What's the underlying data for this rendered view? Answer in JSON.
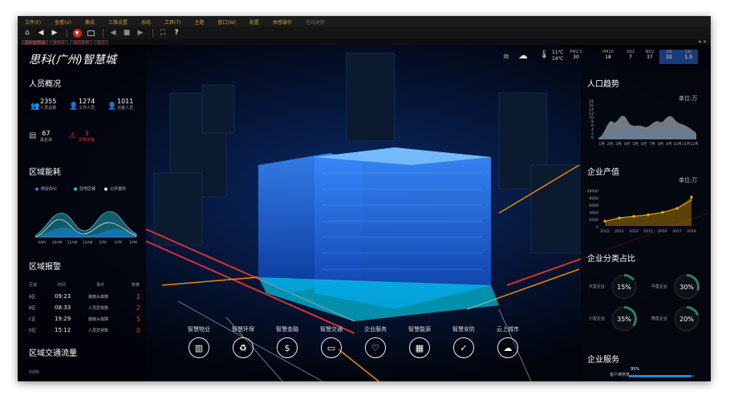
{
  "menubar": [
    "文件(F)",
    "查看(V)",
    "集成",
    "三维设置",
    "系统",
    "工具(T)",
    "主题",
    "窗口(W)",
    "配置",
    "体感操作",
    "在线更新"
  ],
  "tabs": [
    "思科智慧城",
    "宣传片",
    "消防系统",
    "首页"
  ],
  "app": {
    "title": "思科(广州)智慧城"
  },
  "weather": {
    "condition": "阴",
    "temp_high": "11℃",
    "temp_low": "14℃"
  },
  "air": [
    {
      "label": "PM2.5",
      "value": "30"
    },
    {
      "label": "PM10",
      "value": "18"
    },
    {
      "label": "SO2",
      "value": "7"
    },
    {
      "label": "NO2",
      "value": "37"
    },
    {
      "label": "O3",
      "value": "32"
    },
    {
      "label": "CO",
      "value": "1.3"
    }
  ],
  "people": {
    "title": "人员概况",
    "stats": [
      {
        "num": "2355",
        "label": "人员总数",
        "icon": "users-icon"
      },
      {
        "num": "1274",
        "label": "工作人员",
        "icon": "user-icon"
      },
      {
        "num": "1011",
        "label": "访客人员",
        "icon": "visitor-icon"
      }
    ],
    "blacklist": {
      "num": "67",
      "label": "黑名单"
    },
    "abnormal": {
      "num": "3",
      "label": "异常访客"
    }
  },
  "energy": {
    "title": "区域能耗",
    "legend": [
      {
        "label": "商业办公",
        "color": "#1e88e5"
      },
      {
        "label": "住宅区域",
        "color": "#26c6da"
      },
      {
        "label": "公共室外",
        "color": "#e0e0e0"
      }
    ],
    "x": [
      "9AM",
      "10AM",
      "11AM",
      "12AM",
      "1PM",
      "1PM",
      "1PM"
    ]
  },
  "alarm": {
    "title": "区域报警",
    "headers": [
      "区域",
      "时间",
      "事件",
      "数量"
    ],
    "rows": [
      {
        "zone": "A区",
        "time": "09:23",
        "event": "摄像头故障",
        "count": "1"
      },
      {
        "zone": "B区",
        "time": "08:33",
        "event": "人员异常数",
        "count": "2"
      },
      {
        "zone": "C区",
        "time": "19:29",
        "event": "摄像头故障",
        "count": "5"
      },
      {
        "zone": "D区",
        "time": "15:12",
        "event": "人员异常数",
        "count": "0"
      }
    ]
  },
  "traffic": {
    "title": "区域交通流量",
    "y_top": "1000"
  },
  "population": {
    "title": "人口趋势",
    "unit": "单位:万",
    "y_ticks": [
      "18",
      "16",
      "14",
      "12",
      "10",
      "8",
      "6",
      "4",
      "2",
      "0"
    ],
    "x": [
      "1月",
      "2月",
      "3月",
      "4月",
      "5月",
      "6月",
      "7月",
      "8月",
      "9月",
      "10月",
      "11月",
      "12月"
    ]
  },
  "output": {
    "title": "企业产值",
    "unit": "单位:万",
    "y_ticks": [
      "10000",
      "8000",
      "6000",
      "4000",
      "2000",
      "0"
    ],
    "x": [
      "2012",
      "2013",
      "2014",
      "2015",
      "2016",
      "2017",
      "2018"
    ]
  },
  "category": {
    "title": "企业分类占比",
    "items": [
      {
        "label": "大型企业",
        "value": "15%",
        "pct": 15
      },
      {
        "label": "中型企业",
        "value": "30%",
        "pct": 30
      },
      {
        "label": "小型企业",
        "value": "35%",
        "pct": 35
      },
      {
        "label": "微型企业",
        "value": "20%",
        "pct": 20
      }
    ]
  },
  "service": {
    "title": "企业服务",
    "bar_label": "客户满意度",
    "bar_value": "95%",
    "bar_pct": 95
  },
  "services": [
    {
      "label": "智慧物业",
      "icon": "building-icon"
    },
    {
      "label": "智慧环保",
      "icon": "recycle-icon"
    },
    {
      "label": "智慧金融",
      "icon": "money-bag-icon"
    },
    {
      "label": "智慧交通",
      "icon": "bus-icon"
    },
    {
      "label": "企业服务",
      "icon": "heart-hand-icon"
    },
    {
      "label": "智慧能源",
      "icon": "energy-icon"
    },
    {
      "label": "智慧安防",
      "icon": "shield-check-icon"
    },
    {
      "label": "云上城市",
      "icon": "cloud-icon"
    }
  ]
}
